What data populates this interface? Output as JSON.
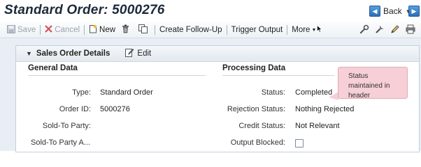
{
  "page": {
    "title": "Standard Order: 5000276"
  },
  "nav": {
    "back_label": "Back"
  },
  "toolbar": {
    "save_label": "Save",
    "cancel_label": "Cancel",
    "new_label": "New",
    "create_followup_label": "Create Follow-Up",
    "trigger_output_label": "Trigger Output",
    "more_label": "More"
  },
  "panel": {
    "title": "Sales Order Details",
    "edit_label": "Edit",
    "general": {
      "title": "General Data",
      "rows": [
        {
          "label": "Type:",
          "value": "Standard Order"
        },
        {
          "label": "Order ID:",
          "value": "5000276"
        },
        {
          "label": "Sold-To Party:",
          "value": ""
        },
        {
          "label": "Sold-To Party A...",
          "value": ""
        }
      ]
    },
    "processing": {
      "title": "Processing Data",
      "rows": [
        {
          "label": "Status:",
          "value": "Completed"
        },
        {
          "label": "Rejection Status:",
          "value": "Nothing Rejected"
        },
        {
          "label": "Credit Status:",
          "value": "Not Relevant"
        },
        {
          "label": "Output Blocked:",
          "value": "",
          "checked": false
        }
      ]
    }
  },
  "callout": {
    "text": "Status maintained in header"
  }
}
